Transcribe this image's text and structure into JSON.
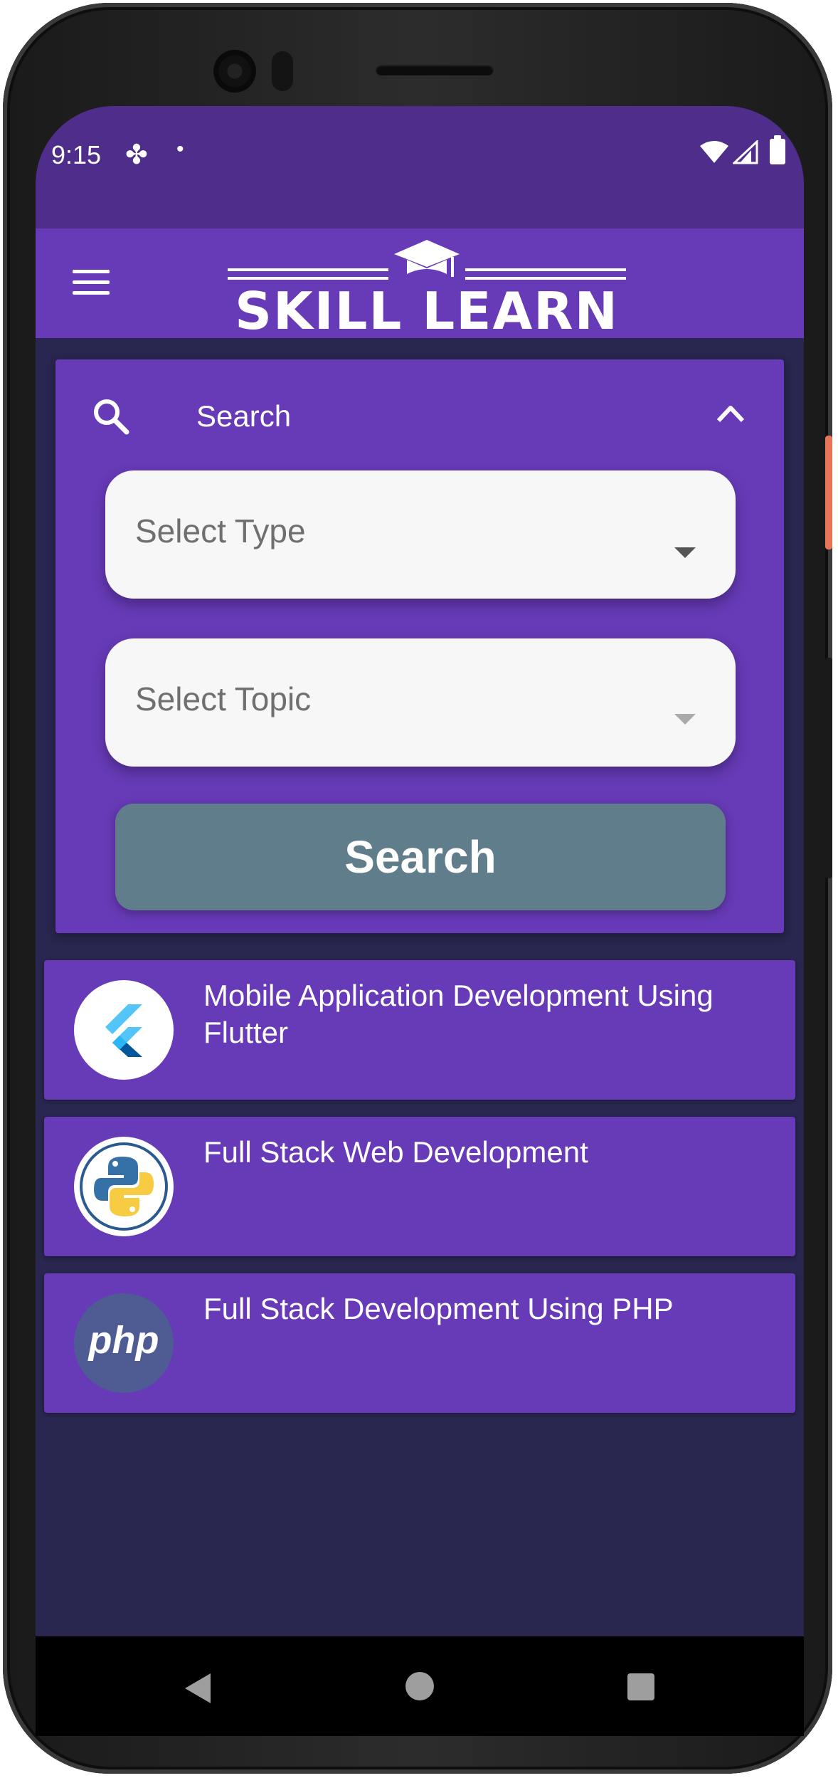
{
  "status_bar": {
    "time": "9:15",
    "icons": [
      "fan-icon",
      "notification-dot-icon",
      "wifi-icon",
      "signal-icon",
      "battery-icon"
    ]
  },
  "app_bar": {
    "logo_text": "SKILL LEARN",
    "menu_icon": "menu-icon"
  },
  "search_panel": {
    "title": "Search",
    "search_icon": "search-icon",
    "collapse_icon": "chevron-up-icon",
    "type_dropdown": {
      "placeholder": "Select Type"
    },
    "topic_dropdown": {
      "placeholder": "Select Topic"
    },
    "submit_label": "Search"
  },
  "courses": [
    {
      "title": "Mobile Application Development Using Flutter",
      "icon": "flutter-icon"
    },
    {
      "title": "Full Stack Web Development",
      "icon": "python-icon"
    },
    {
      "title": "Full Stack Development Using PHP",
      "icon": "php-icon",
      "icon_text": "php"
    }
  ],
  "nav_bar": {
    "icons": [
      "back-icon",
      "home-icon",
      "recents-icon"
    ]
  },
  "colors": {
    "primary": "#673ab7",
    "status_bar": "#4f2d8b",
    "background": "#29264f",
    "button": "#607d8b"
  }
}
